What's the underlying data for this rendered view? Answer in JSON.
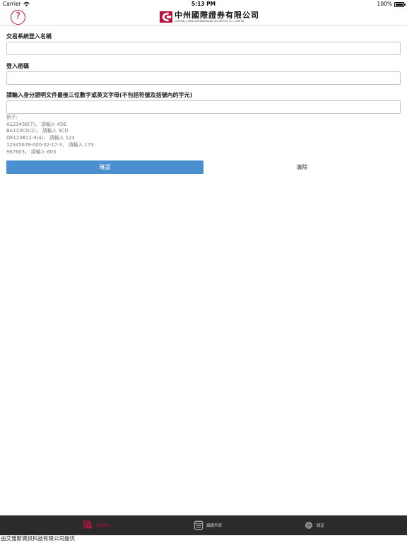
{
  "status_bar": {
    "carrier": "Carrier",
    "time": "5:13 PM",
    "battery": "100%"
  },
  "header": {
    "help_symbol": "?",
    "brand_name": "中州國際證券有限公司",
    "brand_english": "CENTRAL CHINA INTERNATIONAL SECURITIES CO., LIMITED"
  },
  "form": {
    "username_label": "交易系統登入名稱",
    "username_value": "",
    "password_label": "登入密碼",
    "password_value": "",
    "id_label": "請輸入身分證明文件最後三位數字或英文字母(不包括符號及括號內的字元)",
    "id_value": "",
    "examples_title": "例子:",
    "examples": [
      "A123456(7)， 請輸入 456",
      "BA123CD(2)， 請輸入 3CD",
      "DE123B12-3(4)， 請輸入 123",
      "12345678-000-02-17-3， 請輸入 173",
      "967603， 請輸入 603"
    ],
    "confirm_label": "確認",
    "clear_label": "清除"
  },
  "tab_bar": {
    "tabs": [
      {
        "label": "交易登入",
        "icon": "trade-login-icon",
        "active": true
      },
      {
        "label": "編碼列表",
        "icon": "code-list-icon",
        "active": false
      },
      {
        "label": "設定",
        "icon": "settings-gear-icon",
        "active": false
      }
    ]
  },
  "footer": {
    "note": "由艾雅斯資訊科技有限公司提供"
  },
  "colors": {
    "brand_red": "#b8123f",
    "confirm_blue": "#4a8fd0",
    "tab_bar_bg": "#2b2b2b"
  }
}
